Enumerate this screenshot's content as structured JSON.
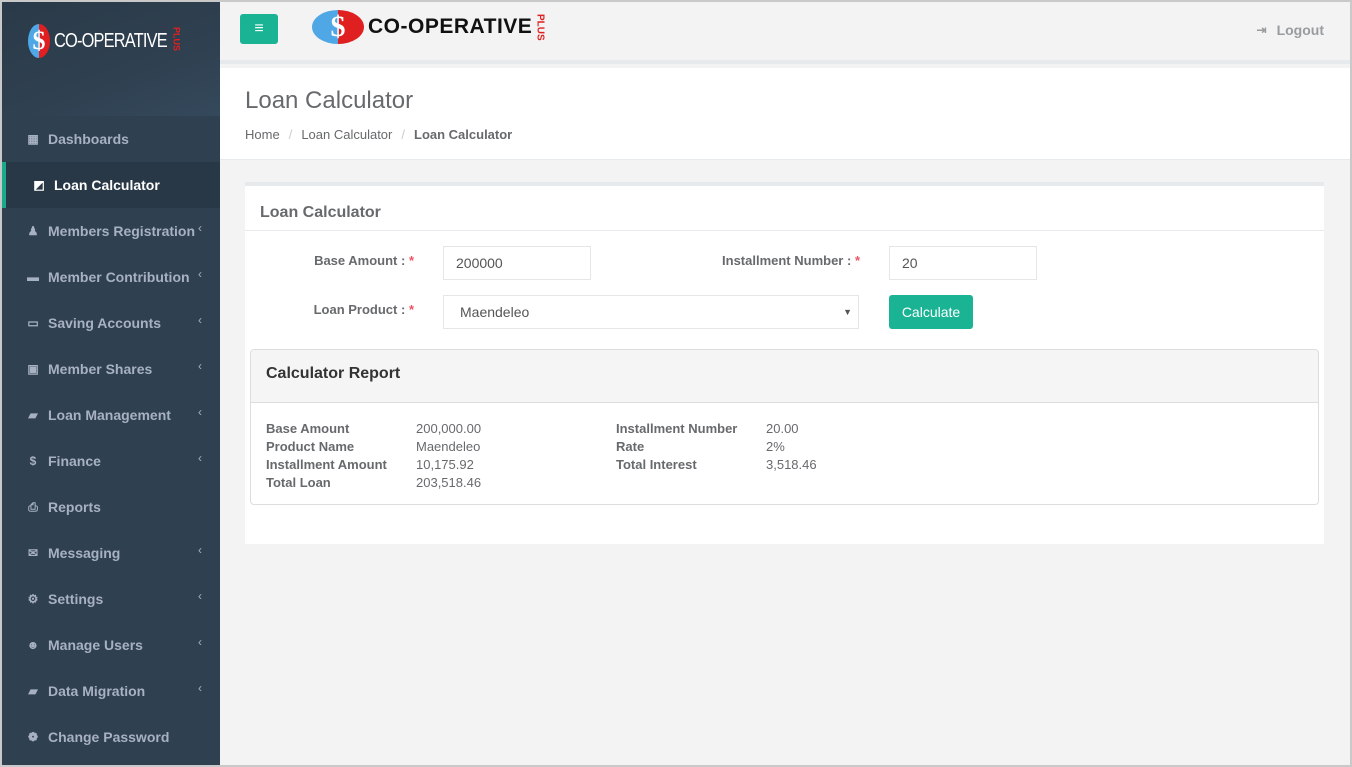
{
  "app": {
    "brand_name": "CO-OPERATIVE",
    "brand_suffix": "PLUS",
    "coin_glyph": "$"
  },
  "colors": {
    "accent": "#1ab394",
    "sidebar_bg": "#2f4050",
    "required": "#ed5565"
  },
  "sidebar": {
    "items": [
      {
        "label": "Dashboards",
        "icon": "dashboard-icon",
        "glyph": "▦",
        "has_submenu": false,
        "active": false
      },
      {
        "label": "Loan Calculator",
        "icon": "calculator-icon",
        "glyph": "◩",
        "has_submenu": false,
        "active": true
      },
      {
        "label": "Members Registration",
        "icon": "user-md-icon",
        "glyph": "♟",
        "has_submenu": true,
        "active": false
      },
      {
        "label": "Member Contribution",
        "icon": "folder-icon",
        "glyph": "▬",
        "has_submenu": true,
        "active": false
      },
      {
        "label": "Saving Accounts",
        "icon": "credit-card-icon",
        "glyph": "▭",
        "has_submenu": true,
        "active": false
      },
      {
        "label": "Member Shares",
        "icon": "briefcase-icon",
        "glyph": "▣",
        "has_submenu": true,
        "active": false
      },
      {
        "label": "Loan Management",
        "icon": "book-icon",
        "glyph": "▰",
        "has_submenu": true,
        "active": false
      },
      {
        "label": "Finance",
        "icon": "dollar-icon",
        "glyph": "$",
        "has_submenu": true,
        "active": false
      },
      {
        "label": "Reports",
        "icon": "print-icon",
        "glyph": "⎙",
        "has_submenu": false,
        "active": false
      },
      {
        "label": "Messaging",
        "icon": "envelope-icon",
        "glyph": "✉",
        "has_submenu": true,
        "active": false
      },
      {
        "label": "Settings",
        "icon": "cogs-icon",
        "glyph": "⚙",
        "has_submenu": true,
        "active": false
      },
      {
        "label": "Manage Users",
        "icon": "users-icon",
        "glyph": "☻",
        "has_submenu": true,
        "active": false
      },
      {
        "label": "Data Migration",
        "icon": "book-icon",
        "glyph": "▰",
        "has_submenu": true,
        "active": false
      },
      {
        "label": "Change Password",
        "icon": "paw-icon",
        "glyph": "❁",
        "has_submenu": false,
        "active": false
      }
    ],
    "chevron_glyph": "‹"
  },
  "topbar": {
    "menu_glyph": "≡",
    "logout_label": "Logout",
    "logout_glyph": "⇥"
  },
  "page": {
    "title": "Loan Calculator",
    "breadcrumb": [
      "Home",
      "Loan Calculator",
      "Loan Calculator"
    ],
    "breadcrumb_sep": "/"
  },
  "form": {
    "box_title": "Loan Calculator",
    "base_amount_label": "Base Amount :",
    "base_amount_value": "200000",
    "installment_label": "Installment Number :",
    "installment_value": "20",
    "loan_product_label": "Loan Product :",
    "loan_product_value": "Maendeleo",
    "required_mark": "*",
    "select_arrow": "▼",
    "calculate_label": "Calculate"
  },
  "report": {
    "title": "Calculator Report",
    "left": [
      {
        "key": "Base Amount",
        "value": "200,000.00"
      },
      {
        "key": "Product Name",
        "value": "Maendeleo"
      },
      {
        "key": "Installment Amount",
        "value": "10,175.92"
      },
      {
        "key": "Total Loan",
        "value": "203,518.46"
      }
    ],
    "right": [
      {
        "key": "Installment Number",
        "value": "20.00"
      },
      {
        "key": "Rate",
        "value": "2%"
      },
      {
        "key": "Total Interest",
        "value": "3,518.46"
      }
    ]
  }
}
